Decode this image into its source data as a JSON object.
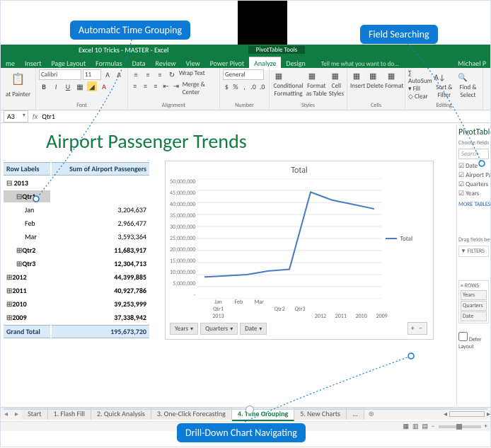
{
  "annotations": {
    "time_grouping": "Automatic Time Grouping",
    "field_searching": "Field Searching",
    "drill_down": "Drill-Down Chart Navigating"
  },
  "window": {
    "title": "Excel 10 Tricks - MASTER - Excel",
    "tools_title": "PivotTable Tools",
    "user": "Michael P"
  },
  "tabs": {
    "main": [
      "me",
      "Insert",
      "Page Layout",
      "Formulas",
      "Data",
      "Review",
      "View",
      "Power Pivot"
    ],
    "tools": [
      "Analyze",
      "Design"
    ],
    "tell_me": "Tell me what you want to do...",
    "active_tool": "Analyze"
  },
  "ribbon": {
    "paste": "Paste",
    "painter": "at Painter",
    "font_name": "Calibri",
    "font_size": "11",
    "wrap": "Wrap Text",
    "merge": "Merge & Center",
    "num_format": "General",
    "cond": "Conditional Formatting",
    "fmt_table": "Format as Table",
    "styles": "Cell Styles",
    "insert": "Insert",
    "delete": "Delete",
    "format": "Format",
    "autosum": "AutoSum",
    "fill": "Fill",
    "clear": "Clear",
    "sort": "Sort & Filter",
    "find": "Find & Select",
    "groups": {
      "font": "Font",
      "align": "Alignment",
      "num": "Number",
      "styles": "Styles",
      "cells": "Cells",
      "edit": "Editing"
    }
  },
  "formula_bar": {
    "name": "A3",
    "value": "Qtr1"
  },
  "report": {
    "title": "Airport Passenger Trends",
    "col_rows": "Row Labels",
    "col_val": "Sum of Airport Passengers",
    "year_2013": "2013",
    "qtr1": "Qtr1",
    "jan": "Jan",
    "feb": "Feb",
    "mar": "Mar",
    "qtr2": "Qtr2",
    "qtr3": "Qtr3",
    "y2012": "2012",
    "y2011": "2011",
    "y2010": "2010",
    "y2009": "2009",
    "grand": "Grand Total",
    "v_jan": "3,204,637",
    "v_feb": "2,966,477",
    "v_mar": "3,593,364",
    "v_q2": "11,683,917",
    "v_q3": "12,304,713",
    "v_2012": "44,399,885",
    "v_2011": "40,927,786",
    "v_2010": "39,253,999",
    "v_2009": "37,338,942",
    "v_total": "195,673,720"
  },
  "chart_data": {
    "type": "line",
    "title": "Total",
    "series": [
      {
        "name": "Total",
        "values": [
          9000000,
          9500000,
          10000000,
          11500000,
          12200000,
          44300000,
          41000000,
          39200000,
          37300000
        ]
      }
    ],
    "categories_bottom": [
      "Jan",
      "Feb",
      "Mar",
      "",
      "",
      "",
      "",
      "",
      ""
    ],
    "categories_mid": [
      "Qtr1",
      "",
      "",
      "Qtr2",
      "Qtr3",
      "",
      "",
      "",
      ""
    ],
    "categories_top": [
      "2013",
      "",
      "",
      "",
      "",
      "2012",
      "2011",
      "2010",
      "2009"
    ],
    "ylim": [
      0,
      50000000
    ],
    "y_ticks": [
      "50,000,000",
      "45,000,000",
      "40,000,000",
      "35,000,000",
      "30,000,000",
      "25,000,000",
      "20,000,000",
      "15,000,000",
      "10,000,000",
      "5,000,000",
      "-"
    ],
    "buttons": [
      "Years",
      "Quarters",
      "Date"
    ],
    "legend": "Total",
    "drill": "+ −"
  },
  "field_pane": {
    "title": "PivotTable",
    "hint": "Choose fields to a",
    "search_placeholder": "Search",
    "fields": [
      "Date",
      "Airport Passe",
      "Quarters",
      "Years"
    ],
    "more": "MORE TABLES...",
    "drag_hint": "Drag fields betw",
    "filters": "FILTERS",
    "rows": "ROWS",
    "row_items": [
      "Years",
      "Quarters",
      "Date"
    ],
    "defer": "Defer Layout"
  },
  "sheet_tabs": {
    "tabs": [
      "Start",
      "1. Flash Fill",
      "2. Quick Analysis",
      "3. One-Click Forecasting",
      "4. Time Grouping",
      "5. New Charts"
    ],
    "active": "4. Time Grouping",
    "more": "..."
  }
}
